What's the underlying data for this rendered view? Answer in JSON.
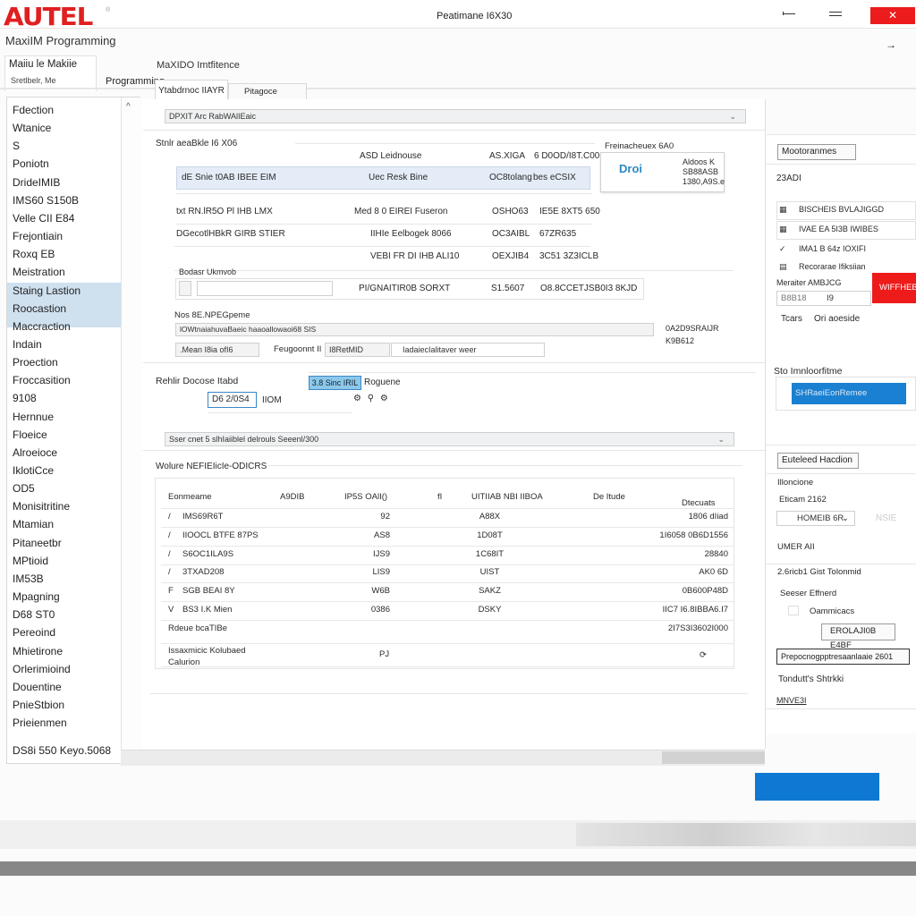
{
  "window": {
    "brand": "AUTEL",
    "brand_mark": "®",
    "title": "Peatimane I6X30",
    "subtitle": "MaxiIM Programming",
    "controls": {
      "minimize": "—",
      "maximize": "=",
      "close": "✕"
    },
    "forward_arrow": "→"
  },
  "tabs": {
    "main_title": "Maiiu le Makiie",
    "main_sub": "Sretlbelr, Me",
    "programming": "Programming",
    "section_title": "MaXIDO Imtfitence",
    "subtabs": [
      {
        "label": "Ytabdrnoc IIAYR",
        "active": true
      },
      {
        "label": "Pitagoce",
        "active": false
      }
    ]
  },
  "sidebar": {
    "scroll_up": "^",
    "items": [
      "Fdection",
      "Wtanice",
      "S",
      "Poniotn",
      "DrideIMIB",
      "IMS60  S150B",
      "Velle CII E84",
      "Frejontiain",
      "Roxq EB",
      "Meistration",
      "Staing Lastion",
      "Roocastion",
      "Maccraction",
      "Indain",
      "Proection",
      "Froccasition",
      "9108",
      "Hernnue",
      "Floeice",
      "Alroeioce",
      "IklotiCce",
      "OD5",
      "Monisitritine",
      "Mtamian",
      "Pitaneetbr",
      "MPtioid",
      "IM53B",
      "Mpagning",
      "D68 ST0",
      "Pereoind",
      "Mhietirone",
      "Orlerimioind",
      "Douentine",
      "PnieStbion",
      "Prieienmen"
    ],
    "selected": [
      "Staing Lastion",
      "Roocastion"
    ],
    "footer": "DS8i 550 Keyo.5068"
  },
  "center": {
    "top_dropdown": "DPXIT Arc RabWAlIEaic",
    "vehicle_section": {
      "title": "Stnlr aeaBkle I6 X06",
      "header": {
        "c2": "ASD Leidnouse",
        "c3": "AS.XIGA",
        "c4": "6 D0OD/I8T.C00"
      },
      "selected_row": {
        "c1": "dE Snie t0AB IBEE EIM",
        "c2": "Uec Resk Bine",
        "c3": "OC8tolang",
        "c4": "bes eCSIX"
      },
      "rows": [
        {
          "c1": "txt RN.lR5O Pl IHB LMX",
          "c2": "Med 8 0 EIREI Fuseron",
          "c3": "OSHO63",
          "c4": "IE5E 8XT5 650"
        },
        {
          "c1": "DGecotlHBkR GIRB STIER",
          "c2": "IIHIe Eelbogek 8066",
          "c3": "OC3AIBL",
          "c4": "67ZR635"
        },
        {
          "c1": "",
          "c2": "VEBI FR DI IHB ALI10",
          "c3": "OEXJIB4",
          "c4": "3C51 3Z3ICLB"
        }
      ],
      "field_label": "Bodasr Ukmvob",
      "input_row": {
        "c2": "PI/GNAITIR0B SORXT",
        "c3": "S1.5607",
        "c4": "O8.8CCETJSB0I3 8KJD"
      },
      "preview": {
        "title": "Freinacheuex 6A0",
        "logo": "Droi",
        "text": [
          "Aldoos K",
          "SB88ASB",
          "1380,A9S.e"
        ]
      }
    },
    "nav_section": {
      "label": "Nos 8E.NPEGpeme",
      "wide_input": "lOWtnaiahuvaBaeic haaoallowaoi68 SIS",
      "side_text": [
        "0A2D9SRAIJR",
        "K9B612"
      ],
      "fields": [
        {
          "label": "",
          "value": ".Mean I8ia ofI6"
        },
        {
          "label": "Feugoonnt II",
          "value": "I8RetMID"
        },
        {
          "label": "",
          "value": "IadaiecIalitaver weer"
        }
      ]
    },
    "device_section": {
      "label": "Rehlir Docose Itabd",
      "chip": "3.8 Sinc IRIL",
      "chip_label": "Roguene",
      "date": "D6 2/0S4",
      "unit": "IIOM",
      "status_dropdown": "Sser cnet 5  slhIaiiblel delrouls Seeenl/300"
    },
    "table": {
      "title": "Wolure NEFIEIicIe-ODICRS",
      "columns": [
        "Eonmeame",
        "A9DIB",
        "IP5S  OAlI()",
        "fI",
        "UITIIAB NBI IIBOA",
        "De Itude",
        "Dtecuats"
      ],
      "rows": [
        {
          "mark": "/",
          "name": "IMS69R6T",
          "v1": "92",
          "v2": "A88X",
          "v3": "1806 dIiad"
        },
        {
          "mark": "/",
          "name": "IIOOCL BTFE 87PS",
          "v1": "AS8",
          "v2": "1D08T",
          "v3": "1I6058 0B6D1556"
        },
        {
          "mark": "/",
          "name": "S6OC1ILA9S",
          "v1": "IJS9",
          "v2": "1C68IT",
          "v3": "28840"
        },
        {
          "mark": "/",
          "name": "3TXAD208",
          "v1": "LIS9",
          "v2": "UIST",
          "v3": "AK0  6D"
        },
        {
          "mark": "F",
          "name": "SGB BEAI 8Y",
          "v1": "W6B",
          "v2": "SAKZ",
          "v3": "0B600P48D"
        },
        {
          "mark": "V",
          "name": "BS3 I.K Mien",
          "v1": "0386",
          "v2": "DSKY",
          "v3": "IIC7 I6.8IBBA6.I7"
        }
      ],
      "summary_row": {
        "name": "Rdeue bcaTIBe",
        "v3": "2I7S3I3602I000"
      },
      "footer_row": {
        "name": "Issaxmicic Kolubaed Calurion",
        "v1": "PJ",
        "icon": "refresh-icon"
      }
    }
  },
  "right": {
    "button_top": "Mootoranmes",
    "count": "23ADI",
    "list": [
      {
        "icon": "▦",
        "label": "BISCHEIS BVLAJIGGD"
      },
      {
        "icon": "▦",
        "label": "IVAE EA 5I3B IWIBES"
      },
      {
        "icon": "✓",
        "label": "IMA1 B 64z IOXIFI"
      },
      {
        "icon": "▤",
        "label": "Recorarae Ifiksiian"
      }
    ],
    "mini_label": "Meraiter AMBJCG",
    "mini_input": "B8B18",
    "mini_value": "I9",
    "red_button": "WIFFHEB",
    "tiers_label": "Tcars",
    "tiers_value": "Ori aoeside",
    "section_title": "Sto Imnloorfitme",
    "blue_select": "SHRaeiEonRemee",
    "button_mid": "Euteleed Hacdion",
    "mid_label": "Illoncione",
    "mid_value": "Eticam 2162",
    "combo": "HOMEIB 6R",
    "combo_side": "NSIE",
    "user_label": "UMER AII",
    "sub_section": "2.6ricb1 Gist Tolonmid",
    "sub_label": "Seeser Effnerd",
    "checkbox_label": "Oammicacs",
    "sub_button": "EROLAJI0B E4BF",
    "wide_button": "Prepocnogpptresaanlaaie 2601",
    "tondut_label": "Tondutt's Shtrkki",
    "footer_tag": "MNVE3I"
  },
  "colors": {
    "brand_red": "#e02020",
    "close_red": "#ec1c1c",
    "accent_blue": "#1a80d1",
    "selection_blue": "#cfe0ee",
    "chip_blue": "#8dc8ea"
  }
}
